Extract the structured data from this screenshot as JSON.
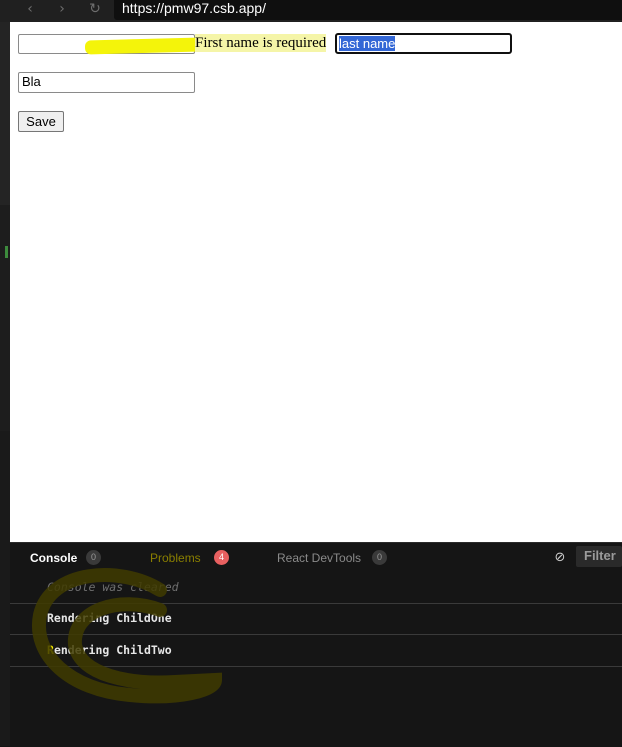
{
  "browser": {
    "url": "https://pmw97.csb.app/",
    "icons": [
      "back-icon",
      "forward-icon",
      "reload-icon"
    ]
  },
  "form": {
    "first_name_value": "",
    "error_message": "First name is required",
    "last_name_value": "last name",
    "second_field_value": "Bla",
    "save_label": "Save"
  },
  "console": {
    "tabs": [
      {
        "label": "Console",
        "count": "0"
      },
      {
        "label": "Problems",
        "count": "4"
      },
      {
        "label": "React DevTools",
        "count": "0"
      }
    ],
    "filter_label": "Filter",
    "logs": [
      {
        "text": "Console was cleared",
        "kind": "info"
      },
      {
        "text": "Rendering ChildOne",
        "kind": "log"
      },
      {
        "text": "Rendering ChildTwo",
        "kind": "log"
      }
    ]
  },
  "colors": {
    "highlight": "#f4f40a",
    "selection": "#3367d6",
    "problems_badge": "#e86060",
    "console_bg": "#151515"
  }
}
